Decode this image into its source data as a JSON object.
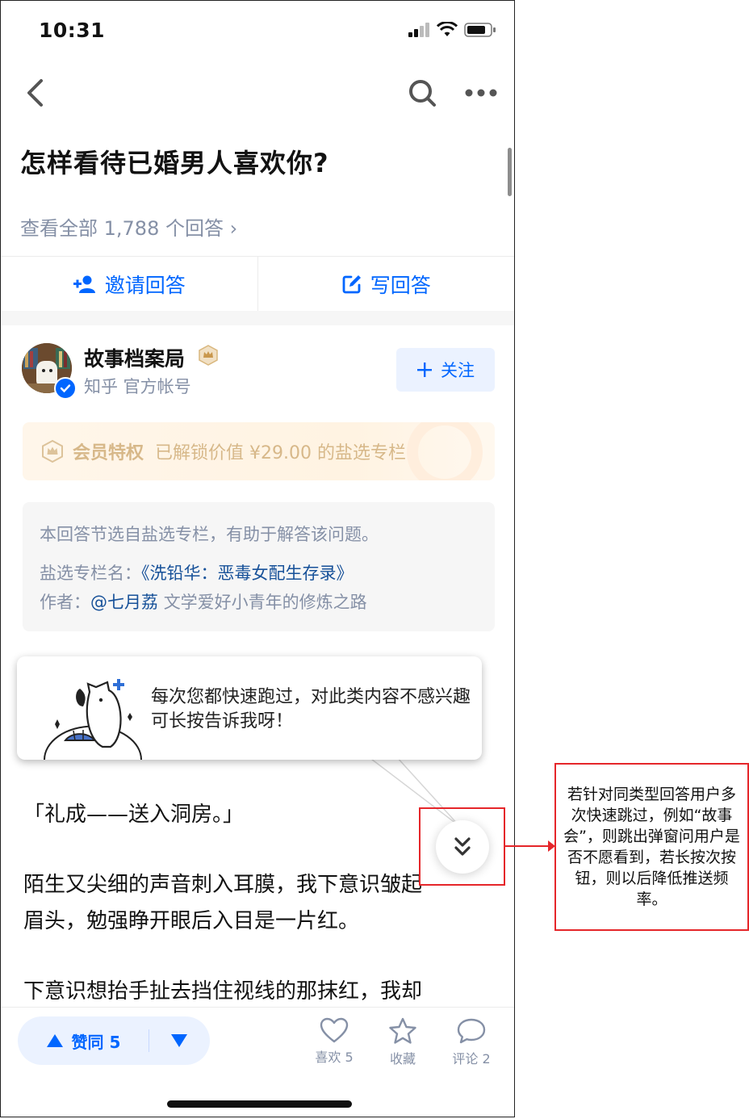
{
  "status_bar": {
    "time": "10:31"
  },
  "question": {
    "title": "怎样看待已婚男人喜欢你?",
    "view_all": "查看全部 1,788 个回答 ›"
  },
  "actions": {
    "invite": "邀请回答",
    "write": "写回答"
  },
  "author": {
    "name": "故事档案局",
    "desc": "知乎 官方帐号",
    "follow": "关注"
  },
  "vip_banner": {
    "title": "会员特权",
    "text": "已解锁价值 ¥29.00 的盐选专栏"
  },
  "column_card": {
    "intro": "本回答节选自盐选专栏，有助于解答该问题。",
    "column_label": "盐选专栏名：",
    "column_name": "《洗铅华：恶毒女配生存录》",
    "author_label": "作者：",
    "author_name": "@七月荔",
    "author_desc": "文学爱好小青年的修炼之路"
  },
  "tooltip": {
    "text": "每次您都快速跑过，对此类内容不感兴趣可长按告诉我呀！"
  },
  "content": {
    "p1": "「礼成——送入洞房。」",
    "p2_line1": "陌生又尖细的声音刺入耳膜，我下意识皱起",
    "p2_line2": "眉头，勉强睁开眼后入目是一片红。",
    "p3_line1": "下意识想抬手扯去挡住视线的那抹红，我却"
  },
  "bottom_bar": {
    "vote_up": "赞同 5",
    "like": "喜欢 5",
    "collect": "收藏",
    "comment": "评论 2"
  },
  "annotation": {
    "note": "若针对同类型回答用户多次快速跳过，例如“故事会”，则跳出弹窗问用户是否不愿看到，若长按次按钮，则以后降低推送频率。"
  },
  "colors": {
    "brand_blue": "#0066ff",
    "vip_gold": "#d7b889",
    "annotation_red": "#e5262a",
    "muted_gray": "#8590a6"
  },
  "icons": [
    "signal-icon",
    "wifi-icon",
    "battery-icon",
    "back-icon",
    "search-icon",
    "more-icon",
    "add-user-icon",
    "edit-icon",
    "verified-icon",
    "vip-crown-icon",
    "plus-icon",
    "double-chevron-down-icon",
    "upvote-icon",
    "downvote-icon",
    "heart-icon",
    "star-icon",
    "comment-icon"
  ]
}
